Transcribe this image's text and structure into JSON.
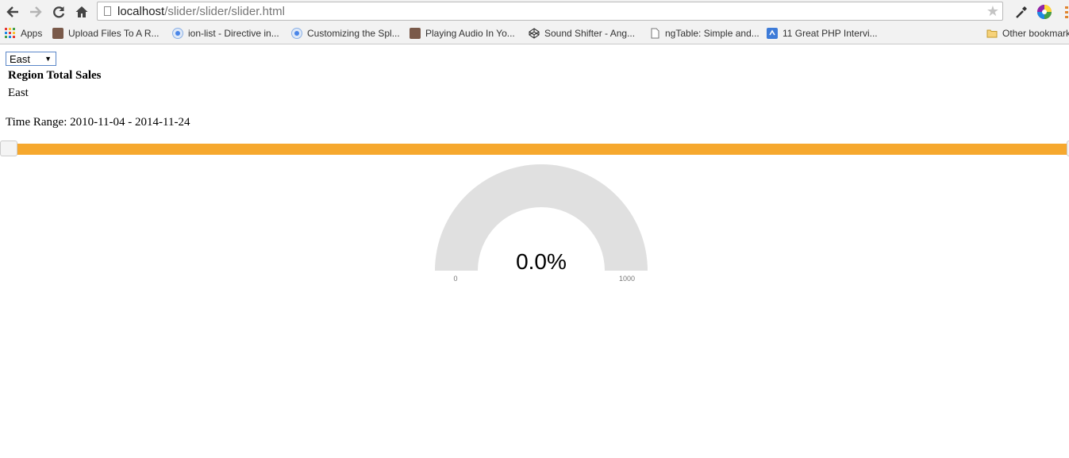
{
  "browser": {
    "url_host": "localhost",
    "url_path": "/slider/slider/slider.html",
    "bookmarks": [
      {
        "label": "Apps",
        "icon": "apps-grid-icon"
      },
      {
        "label": "Upload Files To A R...",
        "icon": "avatar-favicon-icon"
      },
      {
        "label": "ion-list - Directive in...",
        "icon": "chrome-favicon-icon"
      },
      {
        "label": "Customizing the Spl...",
        "icon": "chrome-favicon-icon"
      },
      {
        "label": "Playing Audio In Yo...",
        "icon": "avatar-favicon-icon"
      },
      {
        "label": "Sound Shifter - Ang...",
        "icon": "codepen-icon"
      },
      {
        "label": "ngTable: Simple and...",
        "icon": "page-icon"
      },
      {
        "label": "11 Great PHP Intervi...",
        "icon": "blue-favicon-icon"
      }
    ],
    "other_bookmarks": "Other bookmarks"
  },
  "page": {
    "region_select": {
      "value": "East",
      "options": [
        "East"
      ]
    },
    "heading": "Region Total Sales",
    "region_value": "East",
    "time_range_label": "Time Range: 2010-11-04 - 2014-11-24",
    "slider": {
      "start": "2010-11-04",
      "end": "2014-11-24",
      "color": "#f6a82e"
    },
    "gauge": {
      "value_text": "0.0%",
      "min": 0,
      "max": 1000,
      "value": 0,
      "min_label": "0",
      "max_label": "1000",
      "track_color": "#e0e0e0"
    }
  }
}
